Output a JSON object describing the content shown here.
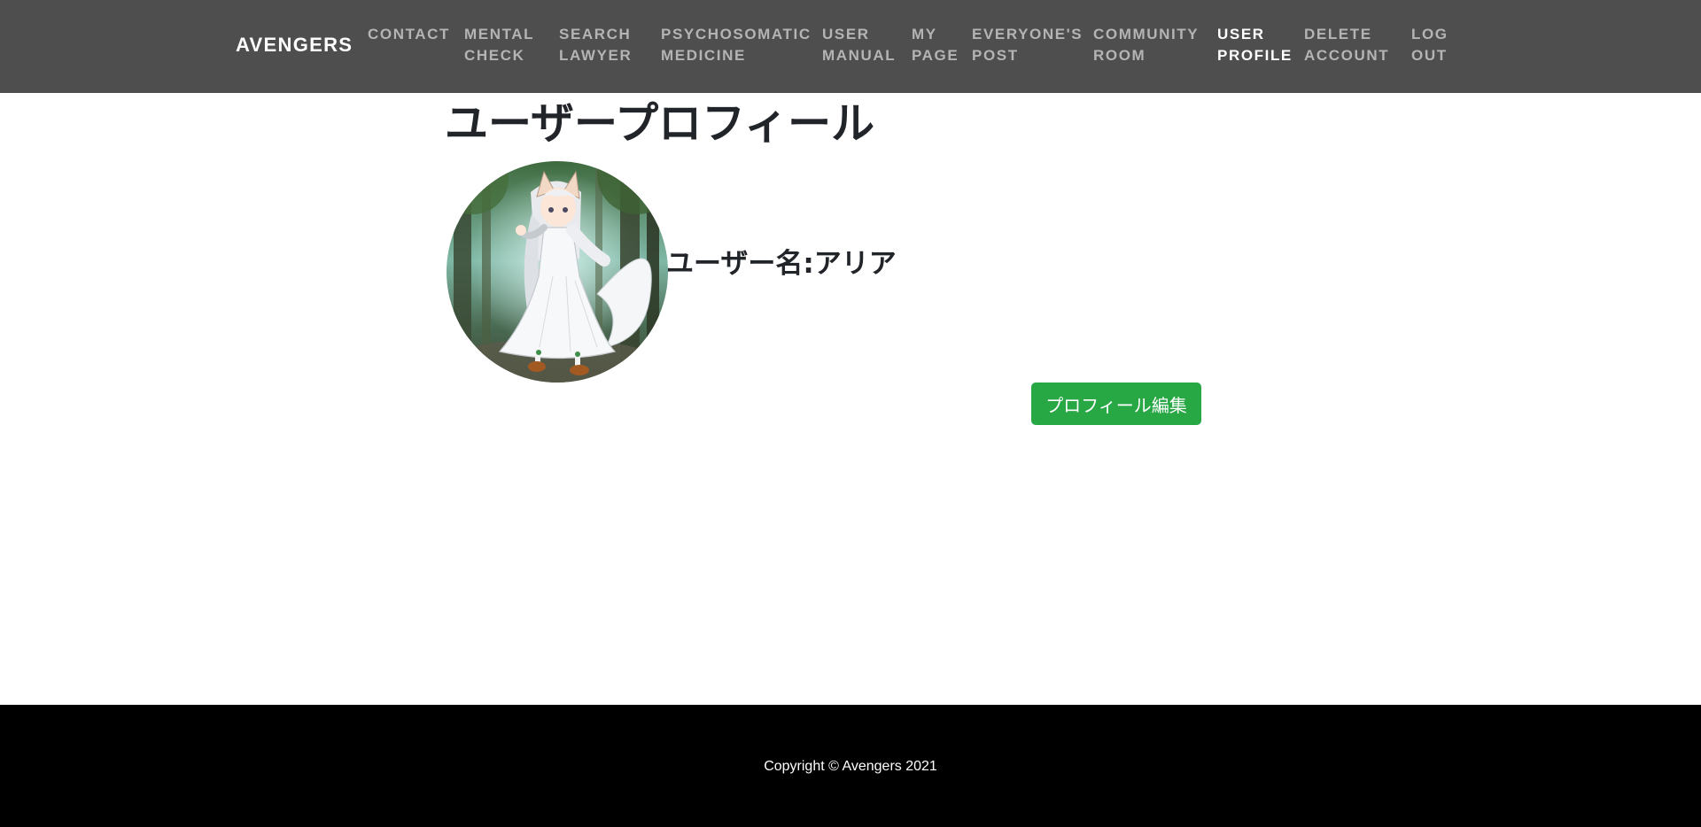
{
  "navbar": {
    "brand": "AVENGERS",
    "items": [
      {
        "line1": "CONTACT",
        "line2": ""
      },
      {
        "line1": "MENTAL",
        "line2": "CHECK"
      },
      {
        "line1": "SEARCH",
        "line2": "LAWYER"
      },
      {
        "line1": "PSYCHOSOMATIC",
        "line2": "MEDICINE"
      },
      {
        "line1": "USER",
        "line2": "MANUAL"
      },
      {
        "line1": "MY",
        "line2": "PAGE"
      },
      {
        "line1": "EVERYONE'S",
        "line2": "POST"
      },
      {
        "line1": "COMMUNITY",
        "line2": "ROOM"
      },
      {
        "line1": "USER",
        "line2": "PROFILE",
        "active": true
      },
      {
        "line1": "DELETE",
        "line2": "ACCOUNT"
      },
      {
        "line1": "LOG",
        "line2": "OUT"
      }
    ]
  },
  "main": {
    "title": "ユーザープロフィール",
    "username": "ユーザー名:アリア",
    "edit_button": "プロフィール編集"
  },
  "footer": {
    "copyright": "Copyright © Avengers 2021"
  },
  "colors": {
    "navbar_bg": "#4e4e4e",
    "nav_text": "#b4b4b4",
    "nav_active": "#ffffff",
    "button_green": "#28a745",
    "footer_bg": "#000000"
  },
  "icons": {
    "avatar": "profile-avatar-illustration"
  }
}
